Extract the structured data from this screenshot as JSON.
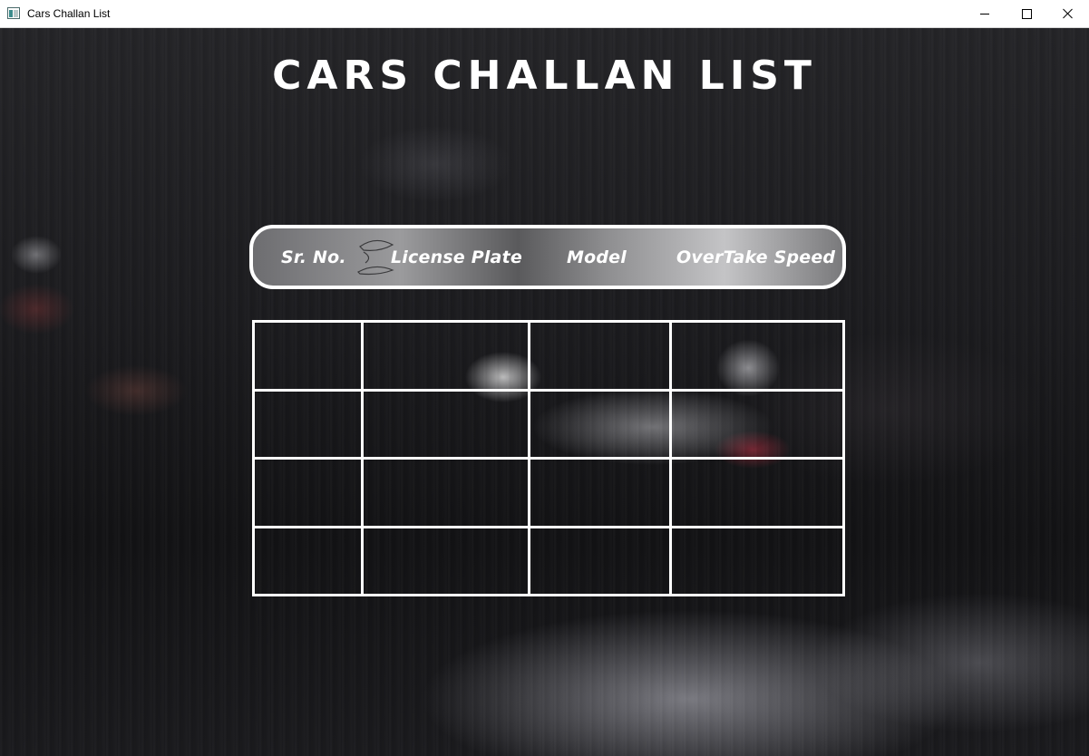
{
  "window": {
    "title": "Cars Challan List",
    "icon": "app-window-icon",
    "controls": [
      "minimize-icon",
      "maximize-icon",
      "close-icon"
    ]
  },
  "page": {
    "heading": "Cars Challan List"
  },
  "table": {
    "columns": [
      "Sr. No.",
      "License Plate",
      "Model",
      "OverTake Speed"
    ],
    "rows": [
      [
        "",
        "",
        "",
        ""
      ],
      [
        "",
        "",
        "",
        ""
      ],
      [
        "",
        "",
        "",
        ""
      ],
      [
        "",
        "",
        "",
        ""
      ]
    ]
  },
  "colors": {
    "heading": "#ffffff",
    "grid_lines": "#ffffff",
    "header_border": "#ffffff"
  }
}
